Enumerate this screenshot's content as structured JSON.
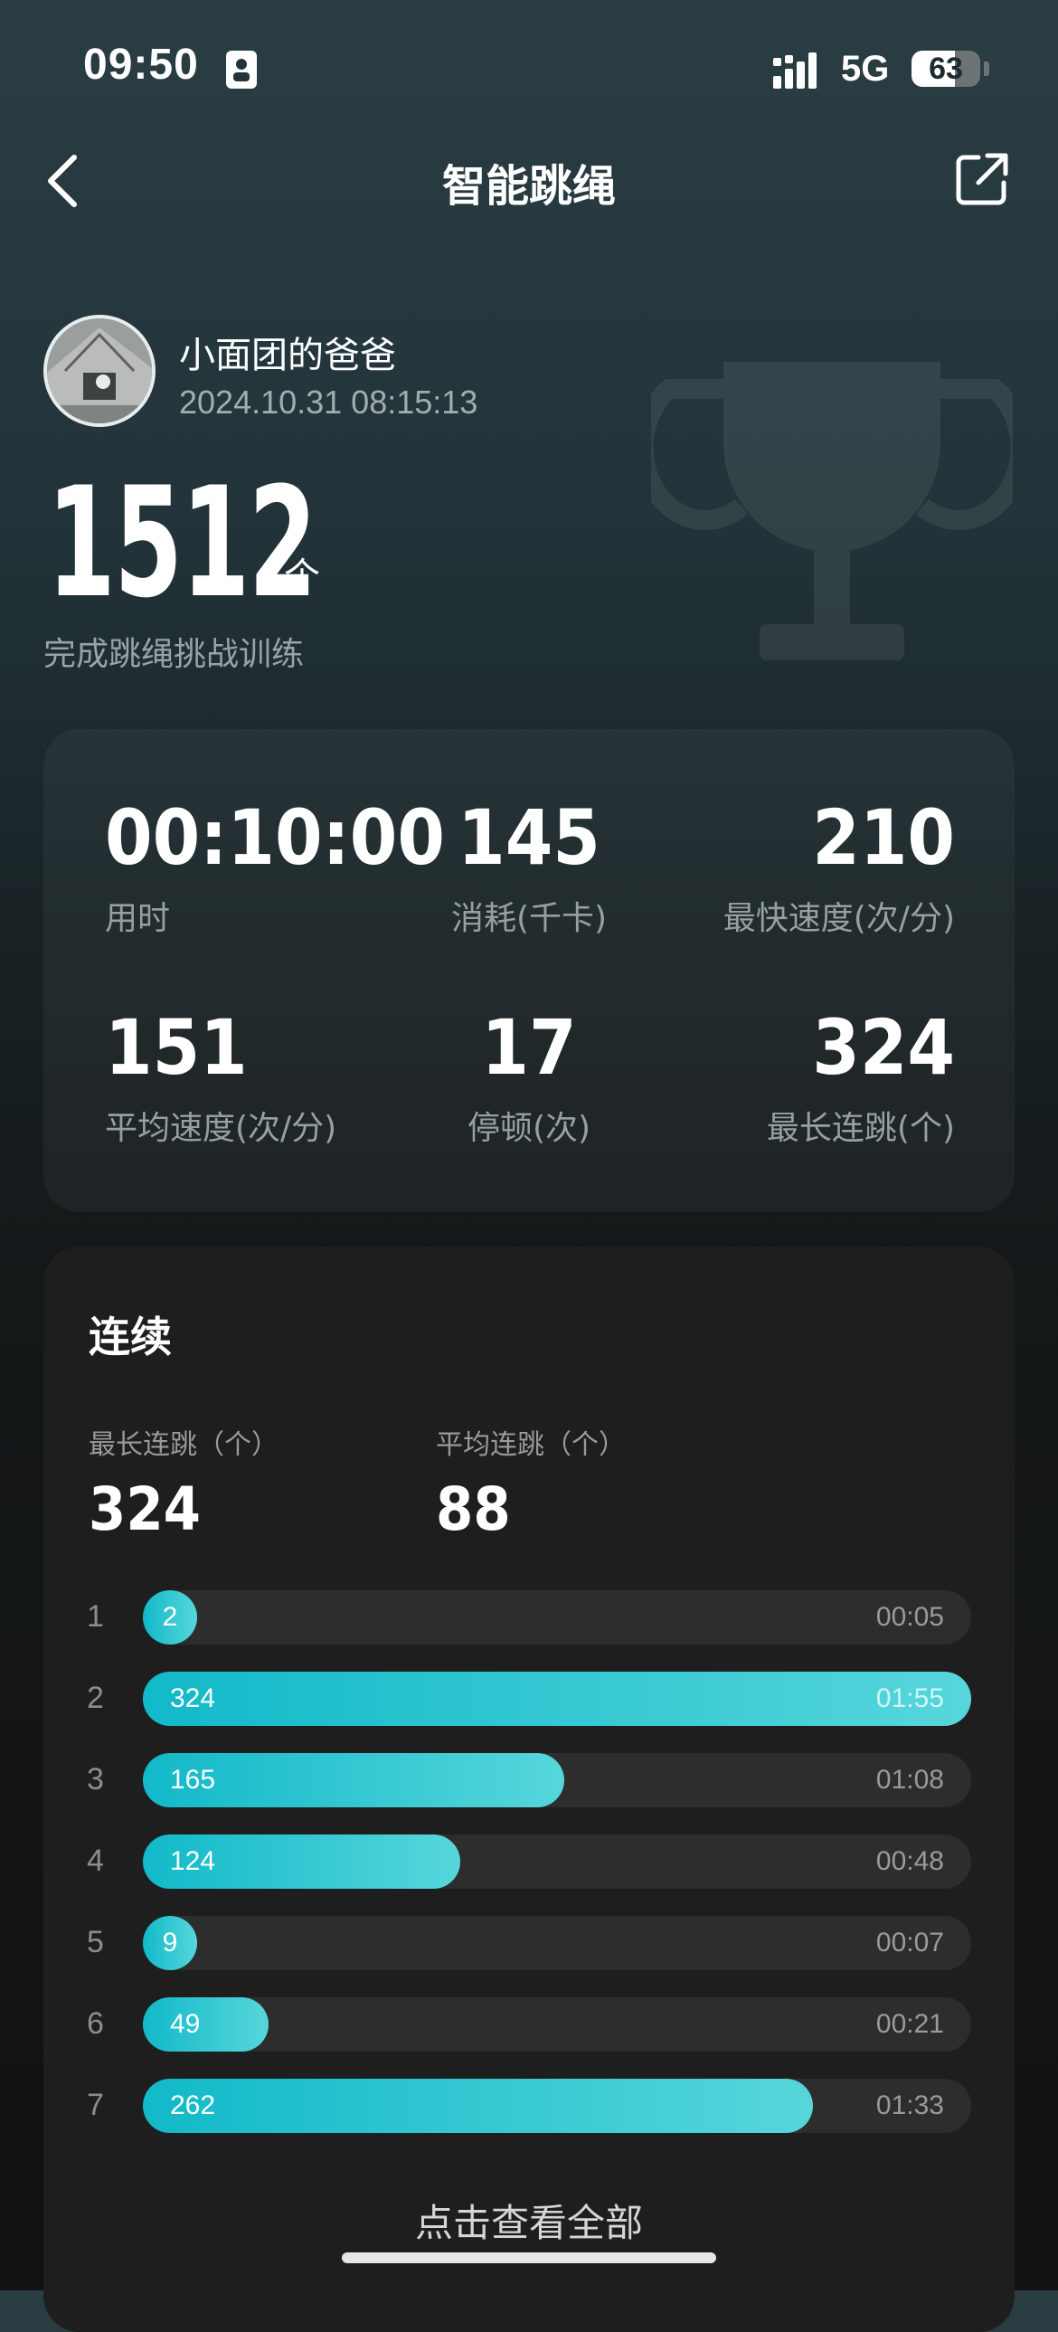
{
  "status_bar": {
    "time": "09:50",
    "network": "5G",
    "battery": "63",
    "battery_level": 0.63,
    "icons": [
      "contact-card-icon",
      "signal-icon"
    ]
  },
  "nav": {
    "title": "智能跳绳",
    "back_icon": "chevron-left-icon",
    "share_icon": "share-icon"
  },
  "user": {
    "name": "小面团的爸爸",
    "datetime": "2024.10.31 08:15:13"
  },
  "summary": {
    "count": "1512",
    "unit": "个",
    "description": "完成跳绳挑战训练"
  },
  "stats": [
    {
      "value": "00:10:00",
      "label": "用时"
    },
    {
      "value": "145",
      "label": "消耗(千卡)"
    },
    {
      "value": "210",
      "label": "最快速度(次/分)"
    },
    {
      "value": "151",
      "label": "平均速度(次/分)"
    },
    {
      "value": "17",
      "label": "停顿(次)"
    },
    {
      "value": "324",
      "label": "最长连跳(个)"
    }
  ],
  "streak": {
    "title": "连续",
    "longest_label": "最长连跳（个）",
    "longest_value": "324",
    "average_label": "平均连跳（个）",
    "average_value": "88",
    "max": 324,
    "bars": [
      {
        "index": "1",
        "count": "2",
        "time": "00:05"
      },
      {
        "index": "2",
        "count": "324",
        "time": "01:55"
      },
      {
        "index": "3",
        "count": "165",
        "time": "01:08"
      },
      {
        "index": "4",
        "count": "124",
        "time": "00:48"
      },
      {
        "index": "5",
        "count": "9",
        "time": "00:07"
      },
      {
        "index": "6",
        "count": "49",
        "time": "00:21"
      },
      {
        "index": "7",
        "count": "262",
        "time": "01:33"
      }
    ],
    "view_all": "点击查看全部"
  },
  "colors": {
    "accent": "#18bccb",
    "accent_end": "#56d6db"
  }
}
